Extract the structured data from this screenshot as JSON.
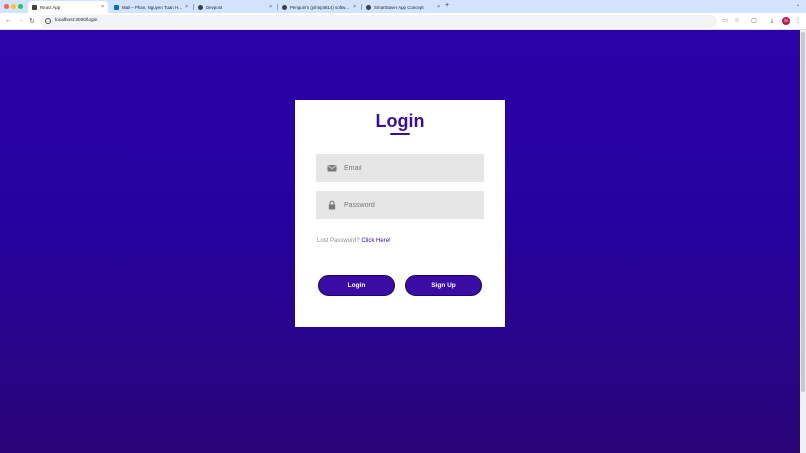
{
  "browser": {
    "tabs": [
      {
        "title": "React App",
        "favicon_color": "#3c4043",
        "active": true
      },
      {
        "title": "Mail – Phan, Nguyen Tuan H…",
        "favicon_color": "#0f6cbd",
        "active": false
      },
      {
        "title": "Devpost",
        "favicon_color": "#3c4043",
        "active": false
      },
      {
        "title": "Penguin's (johnp4814) softw…",
        "favicon_color": "#3c4043",
        "active": false
      },
      {
        "title": "SmartSaver App Concept",
        "favicon_color": "#3c4043",
        "active": false
      }
    ],
    "new_tab_label": "+",
    "url": "localhost:3000/login",
    "profile_initial": "N"
  },
  "login": {
    "title": "Login",
    "email_placeholder": "Email",
    "password_placeholder": "Password",
    "lost_password_text": "Lost Password?",
    "lost_password_link": "Click Here!",
    "login_button": "Login",
    "signup_button": "Sign Up"
  },
  "colors": {
    "accent": "#3a0ca3",
    "background_top": "#2a02a8",
    "background_bottom": "#2a0477"
  }
}
